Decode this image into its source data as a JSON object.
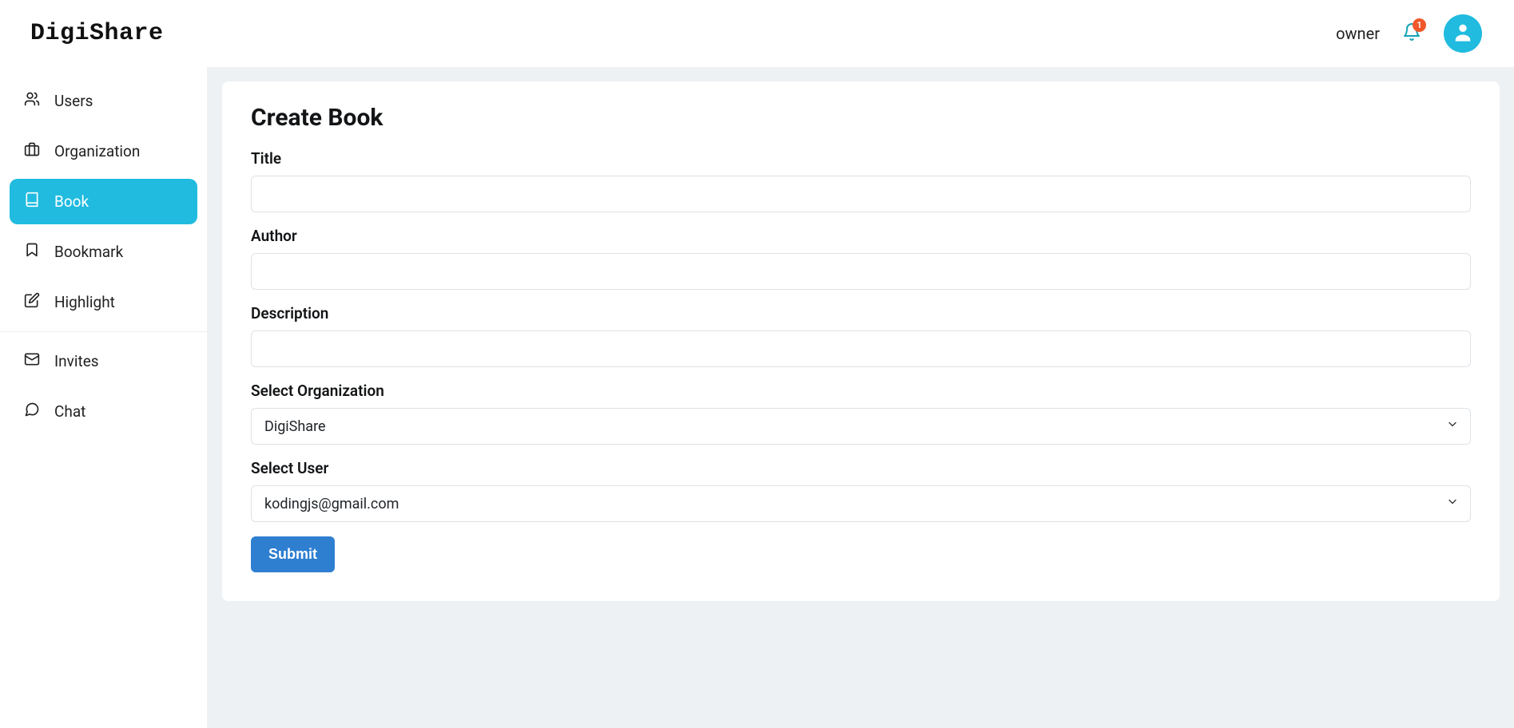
{
  "brand": "DigiShare",
  "header": {
    "role": "owner",
    "notification_count": "1"
  },
  "sidebar": {
    "items": [
      {
        "label": "Users"
      },
      {
        "label": "Organization"
      },
      {
        "label": "Book"
      },
      {
        "label": "Bookmark"
      },
      {
        "label": "Highlight"
      },
      {
        "label": "Invites"
      },
      {
        "label": "Chat"
      }
    ]
  },
  "page": {
    "title": "Create Book",
    "form": {
      "title_label": "Title",
      "title_value": "",
      "author_label": "Author",
      "author_value": "",
      "description_label": "Description",
      "description_value": "",
      "org_label": "Select Organization",
      "org_selected": "DigiShare",
      "user_label": "Select User",
      "user_selected": "kodingjs@gmail.com",
      "submit_label": "Submit"
    }
  }
}
